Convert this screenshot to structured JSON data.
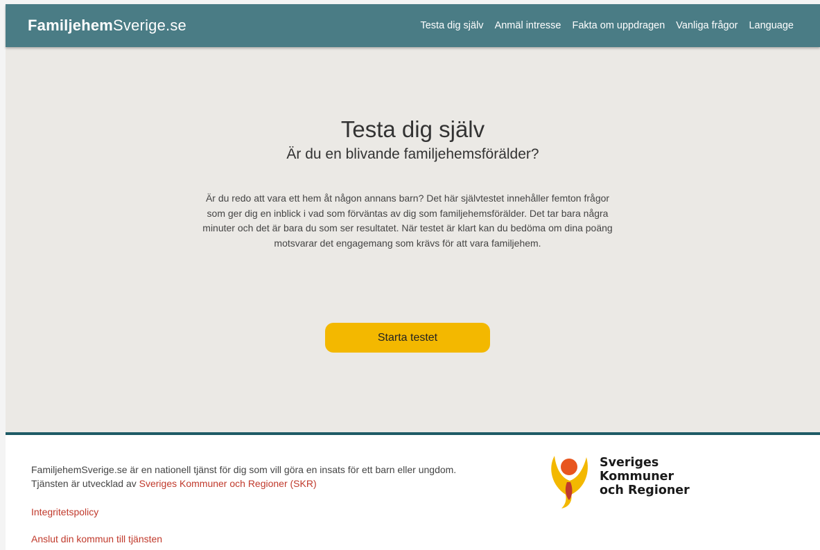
{
  "header": {
    "logo_bold": "Familjehem",
    "logo_light": "Sverige.se",
    "nav": [
      "Testa dig själv",
      "Anmäl intresse",
      "Fakta om uppdragen",
      "Vanliga frågor",
      "Language"
    ]
  },
  "hero": {
    "title": "Testa dig själv",
    "subtitle": "Är du en blivande familjehemsförälder?",
    "intro": "Är du redo att vara ett hem åt någon annans barn? Det här självtestet innehåller femton frågor som ger dig en inblick i vad som förväntas av dig som familjehemsförälder. Det tar bara några minuter och det är bara du som ser resultatet. När testet är klart kan du bedöma om dina poäng motsvarar det engagemang som krävs för att vara familjehem.",
    "start_button": "Starta testet"
  },
  "footer": {
    "text_line1": "FamiljehemSverige.se är en nationell tjänst för dig som vill göra en insats för ett barn eller ungdom.",
    "text_line2_prefix": "Tjänsten är utvecklad av ",
    "text_line2_link": "Sveriges Kommuner och Regioner (SKR)",
    "privacy_link": "Integritetspolicy",
    "join_link": "Anslut din kommun till tjänsten",
    "skr_logo_lines": [
      "Sveriges",
      "Kommuner",
      "och Regioner"
    ]
  },
  "colors": {
    "header_bg": "#4a7c85",
    "hero_bg": "#ebe9e5",
    "button": "#f3b800",
    "divider": "#1e5b66",
    "link": "#c0392b"
  }
}
